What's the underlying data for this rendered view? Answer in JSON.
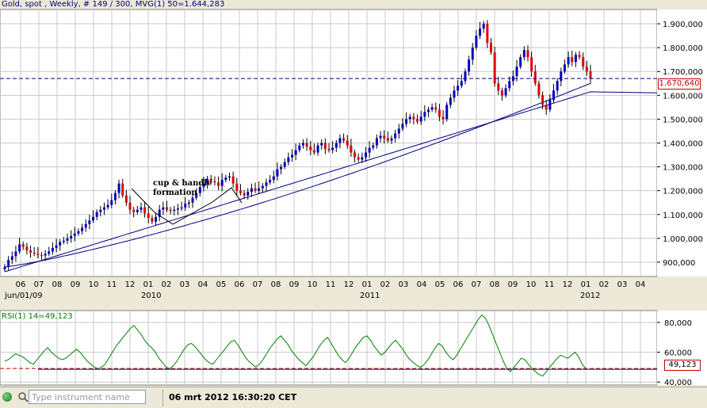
{
  "header": {
    "title": "Gold, spot , Weekly, # 149 / 300, MVG(1) 50=1.644,283"
  },
  "price_badge": "1.670,640",
  "annotation": {
    "line1": "cup & handle",
    "line2": "formation"
  },
  "rsi_header": "RSI(1) 14=49,123",
  "rsi_badge": "49,123",
  "status": {
    "input_placeholder": "Type instrument name",
    "datetime": "06 mrt 2012 16:30:20 CET"
  },
  "colors": {
    "up": "#0000c0",
    "down": "#e00000",
    "grid": "#c8c8c8",
    "ma": "#000080",
    "rsi_line": "#008000",
    "ref_line": "#c00000"
  },
  "chart_data": [
    {
      "type": "candlestick",
      "title": "Gold, spot , Weekly",
      "ylim": [
        840,
        1960
      ],
      "y_ticks": [
        "900,000",
        "1.000,000",
        "1.100,000",
        "1.200,000",
        "1.300,000",
        "1.400,000",
        "1.500,000",
        "1.600,000",
        "1.700,000",
        "1.800,000",
        "1.900,000"
      ],
      "y_tick_values": [
        900,
        1000,
        1100,
        1200,
        1300,
        1400,
        1500,
        1600,
        1700,
        1800,
        1900
      ],
      "x_ticks": [
        "06",
        "07",
        "08",
        "09",
        "10",
        "11",
        "12",
        "01",
        "02",
        "03",
        "04",
        "05",
        "06",
        "07",
        "08",
        "09",
        "10",
        "11",
        "12",
        "01",
        "02",
        "03",
        "04",
        "05",
        "06",
        "07",
        "08",
        "09",
        "10",
        "11",
        "12",
        "01",
        "02",
        "03",
        "04"
      ],
      "year_labels": [
        "jun/01/09",
        "2010",
        "2011",
        "2012"
      ],
      "close_values": [
        880,
        910,
        925,
        945,
        975,
        965,
        950,
        940,
        935,
        930,
        928,
        935,
        945,
        960,
        970,
        985,
        990,
        1000,
        1010,
        1020,
        1030,
        1045,
        1060,
        1075,
        1090,
        1110,
        1120,
        1130,
        1140,
        1160,
        1190,
        1230,
        1180,
        1150,
        1120,
        1110,
        1120,
        1130,
        1105,
        1085,
        1070,
        1090,
        1120,
        1130,
        1120,
        1115,
        1120,
        1125,
        1130,
        1145,
        1150,
        1170,
        1190,
        1215,
        1230,
        1250,
        1240,
        1235,
        1220,
        1245,
        1255,
        1260,
        1230,
        1200,
        1190,
        1180,
        1195,
        1210,
        1200,
        1210,
        1220,
        1235,
        1245,
        1260,
        1290,
        1300,
        1320,
        1340,
        1350,
        1370,
        1390,
        1400,
        1385,
        1370,
        1360,
        1390,
        1400,
        1375,
        1370,
        1380,
        1400,
        1420,
        1410,
        1390,
        1360,
        1340,
        1330,
        1340,
        1360,
        1380,
        1390,
        1420,
        1430,
        1420,
        1410,
        1420,
        1440,
        1460,
        1480,
        1500,
        1510,
        1500,
        1490,
        1510,
        1530,
        1540,
        1550,
        1540,
        1510,
        1500,
        1560,
        1590,
        1620,
        1640,
        1660,
        1700,
        1750,
        1800,
        1850,
        1880,
        1900,
        1820,
        1780,
        1650,
        1620,
        1600,
        1630,
        1660,
        1680,
        1720,
        1760,
        1790,
        1760,
        1700,
        1650,
        1600,
        1560,
        1540,
        1580,
        1620,
        1660,
        1700,
        1730,
        1760,
        1740,
        1770,
        1760,
        1720,
        1700,
        1670
      ],
      "moving_averages": [
        {
          "name": "MVG(1) 50",
          "value": 1644.283,
          "start": 880,
          "end": 1650
        },
        {
          "name": "trendline",
          "start": 860,
          "end": 1600
        }
      ],
      "reference_level": 1670.64,
      "annotations": [
        "cup & handle",
        "formation"
      ]
    },
    {
      "type": "line",
      "title": "RSI(1) 14=49,123",
      "ylim": [
        38,
        88
      ],
      "y_ticks": [
        "40,000",
        "60,000",
        "80,000"
      ],
      "y_tick_values": [
        40,
        60,
        80
      ],
      "reference_level": 49.123,
      "values": [
        54,
        55,
        57,
        59,
        58,
        57,
        55,
        53,
        52,
        55,
        58,
        61,
        63,
        60,
        58,
        56,
        55,
        56,
        58,
        60,
        62,
        60,
        57,
        54,
        52,
        50,
        49,
        50,
        52,
        56,
        60,
        64,
        67,
        70,
        73,
        76,
        78,
        75,
        72,
        68,
        65,
        63,
        60,
        56,
        53,
        50,
        49,
        51,
        54,
        58,
        62,
        65,
        66,
        64,
        61,
        58,
        55,
        53,
        52,
        55,
        58,
        61,
        64,
        67,
        68,
        65,
        61,
        57,
        54,
        52,
        50,
        52,
        55,
        59,
        63,
        66,
        69,
        71,
        68,
        65,
        61,
        58,
        55,
        53,
        51,
        54,
        57,
        61,
        65,
        68,
        70,
        66,
        62,
        58,
        55,
        53,
        56,
        60,
        64,
        67,
        70,
        71,
        68,
        64,
        61,
        58,
        60,
        63,
        66,
        68,
        65,
        62,
        58,
        55,
        53,
        51,
        50,
        52,
        55,
        59,
        63,
        66,
        64,
        60,
        57,
        55,
        58,
        62,
        66,
        70,
        74,
        78,
        82,
        85,
        83,
        78,
        72,
        66,
        60,
        54,
        49,
        47,
        50,
        53,
        56,
        55,
        52,
        49,
        47,
        45,
        44,
        47,
        50,
        53,
        56,
        58,
        57,
        56,
        58,
        60,
        57,
        52,
        49
      ]
    }
  ]
}
